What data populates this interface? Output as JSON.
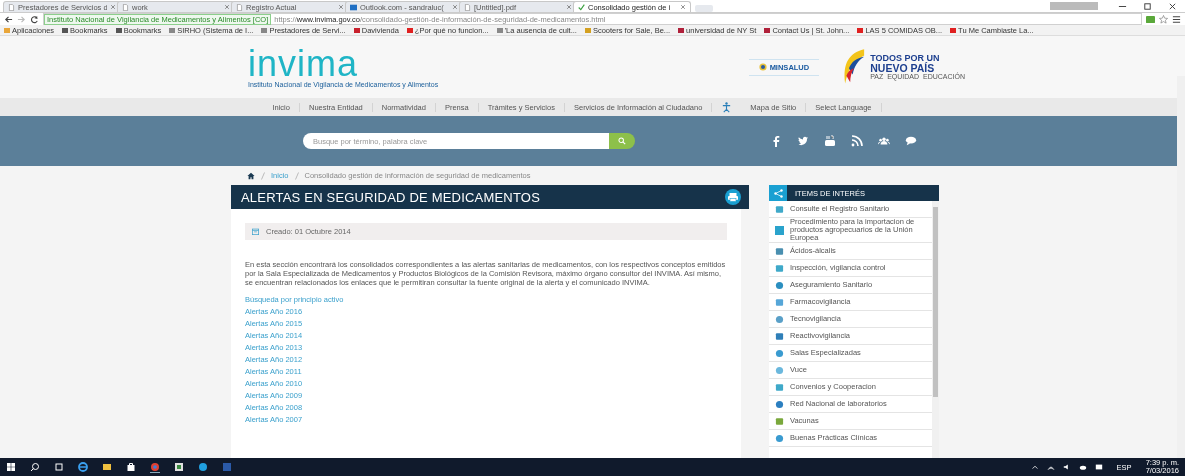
{
  "browser": {
    "tabs": [
      {
        "title": "Prestadores de Servicios d",
        "selected": false
      },
      {
        "title": "work",
        "selected": false
      },
      {
        "title": "Registro Actual",
        "selected": false
      },
      {
        "title": "Outlook.com - sandraluc(",
        "selected": false
      },
      {
        "title": "[Untitled].pdf",
        "selected": false
      },
      {
        "title": "Consolidado gestión de i",
        "selected": true
      }
    ],
    "site_identity": "Instituto Nacional de Vigilancia de Medicamentos y Alimentos [CO]",
    "url_scheme": "https://",
    "url_host": "www.invima.gov.co",
    "url_path": "/consolidado-gestión-de-información-de-seguridad-de-medicamentos.html",
    "bookmarks": [
      "Aplicaciones",
      "Bookmarks",
      "Bookmarks",
      "SIRHO (Sistema de I...",
      "Prestadores de Servi...",
      "Davivienda",
      "¿Por qué no funcion...",
      "'La ausencia de cult...",
      "Scooters for Sale, Be...",
      "universidad de NY St",
      "Contact Us | St. John...",
      "LAS 5 COMIDAS OB...",
      "Tu Me Cambiaste La..."
    ]
  },
  "header": {
    "logo": "invima",
    "logo_subtitle": "Instituto Nacional de Vigilancia de Medicamentos y Alimentos",
    "ministry": "MINSALUD",
    "slogan_top": "TODOS POR UN",
    "slogan_main": "NUEVO PAÍS",
    "slogan_sub": "PAZ  EQUIDAD  EDUCACIÓN"
  },
  "nav": [
    {
      "kind": "link",
      "label": "Inicio"
    },
    {
      "kind": "link",
      "label": "Nuestra Entidad"
    },
    {
      "kind": "link",
      "label": "Normatividad"
    },
    {
      "kind": "link",
      "label": "Prensa"
    },
    {
      "kind": "link",
      "label": "Trámites y Servicios"
    },
    {
      "kind": "link",
      "label": "Servicios de Información al Ciudadano"
    },
    {
      "kind": "accessibility"
    },
    {
      "kind": "link",
      "label": "Mapa de Sitio"
    },
    {
      "kind": "link",
      "label": "Select Language"
    }
  ],
  "search": {
    "placeholder": "Busque por término, palabra clave"
  },
  "breadcrumb": [
    "Inicio",
    "Consolidado gestión de información de seguridad de medicamentos"
  ],
  "article": {
    "title": "ALERTAS EN SEGURIDAD DE MEDICAMENTOS",
    "created": "Creado: 01 Octubre 2014",
    "intro": "En esta sección encontrará los consolidados correspondientes a las alertas sanitarias de medicamentos, con los respectivos conceptos emitidos por la Sala Especializada de Medicamentos y Productos Biológicos de la Comisión Revisora, máximo órgano consultor del INVIMA. Así mismo, se encuentran relacionados los enlaces que le permitiran consultar la fuente original de la alerta y el comunicado INVIMA.",
    "links": [
      "Búsqueda por principio activo",
      "Alertas Año 2016",
      "Alertas Año 2015",
      "Alertas Año 2014",
      "Alertas Año 2013",
      "Alertas Año 2012",
      "Alertas Año 2011",
      "Alertas Año 2010",
      "Alertas Año 2009",
      "Alertas Año 2008",
      "Alertas Año 2007"
    ]
  },
  "sidebar": {
    "title": "ITEMS DE INTERÉS",
    "items": [
      "Consulte el Registro Sanitario",
      "Procedimiento para la importacion de productos agropecuarios de la Unión Europea",
      "Ácidos-álcalis",
      "Inspección, vigilancia control",
      "Aseguramiento Sanitario",
      "Farmacovigilancia",
      "Tecnovigilancia",
      "Reactivovigilancia",
      "Salas Especializadas",
      "Vuce",
      "Convenios y Cooperacion",
      "Red Nacional de laboratorios",
      "Vacunas",
      "Buenas Prácticas Clínicas"
    ]
  },
  "taskbar": {
    "language": "ESP",
    "time": "7:39 p. m.",
    "date": "7/03/2016"
  }
}
